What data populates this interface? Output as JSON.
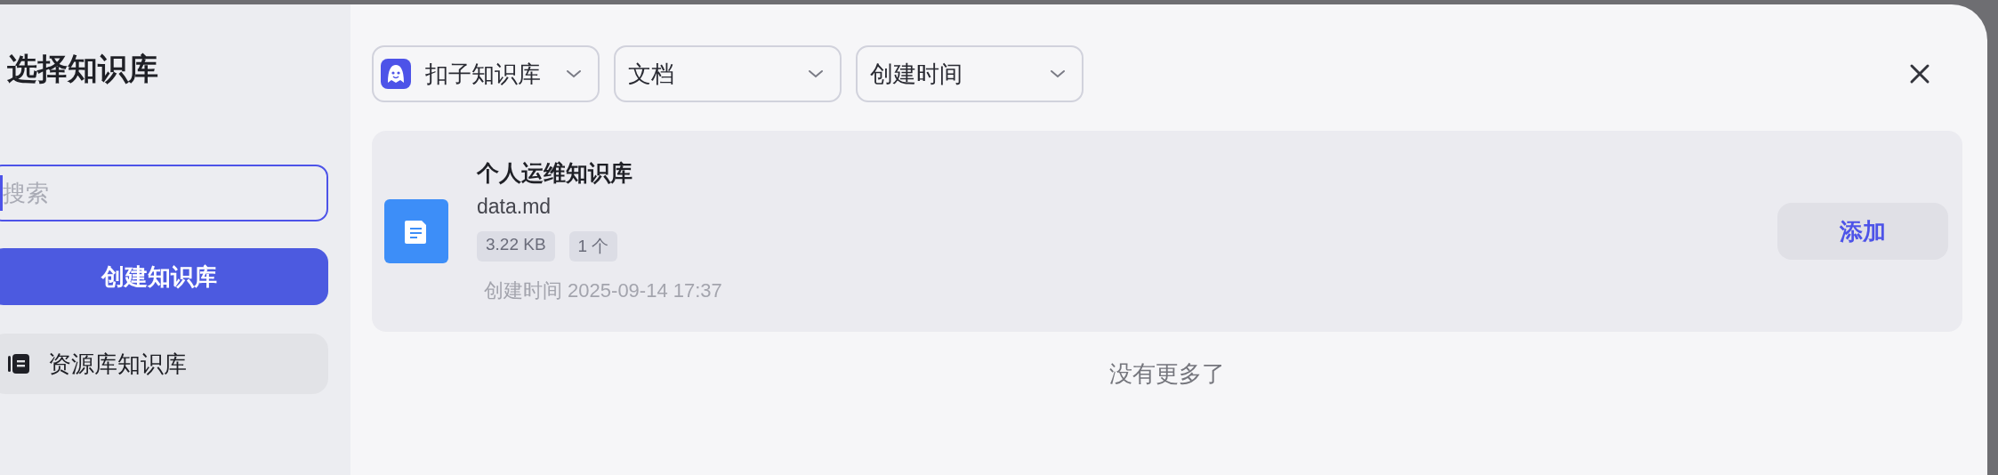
{
  "sidebar": {
    "title": "选择知识库",
    "search": {
      "placeholder": "搜索"
    },
    "create_button": "创建知识库",
    "items": [
      {
        "label": "资源库知识库",
        "selected": true
      }
    ]
  },
  "filters": [
    {
      "label": "扣子知识库",
      "kind": "source"
    },
    {
      "label": "文档",
      "kind": "plain"
    },
    {
      "label": "创建时间",
      "kind": "plain"
    }
  ],
  "results": [
    {
      "title": "个人运维知识库",
      "file": "data.md",
      "tags": [
        "3.22 KB",
        "1 个"
      ],
      "created": "创建时间 2025-09-14 17:37",
      "action": "添加"
    }
  ],
  "end_note": "没有更多了"
}
